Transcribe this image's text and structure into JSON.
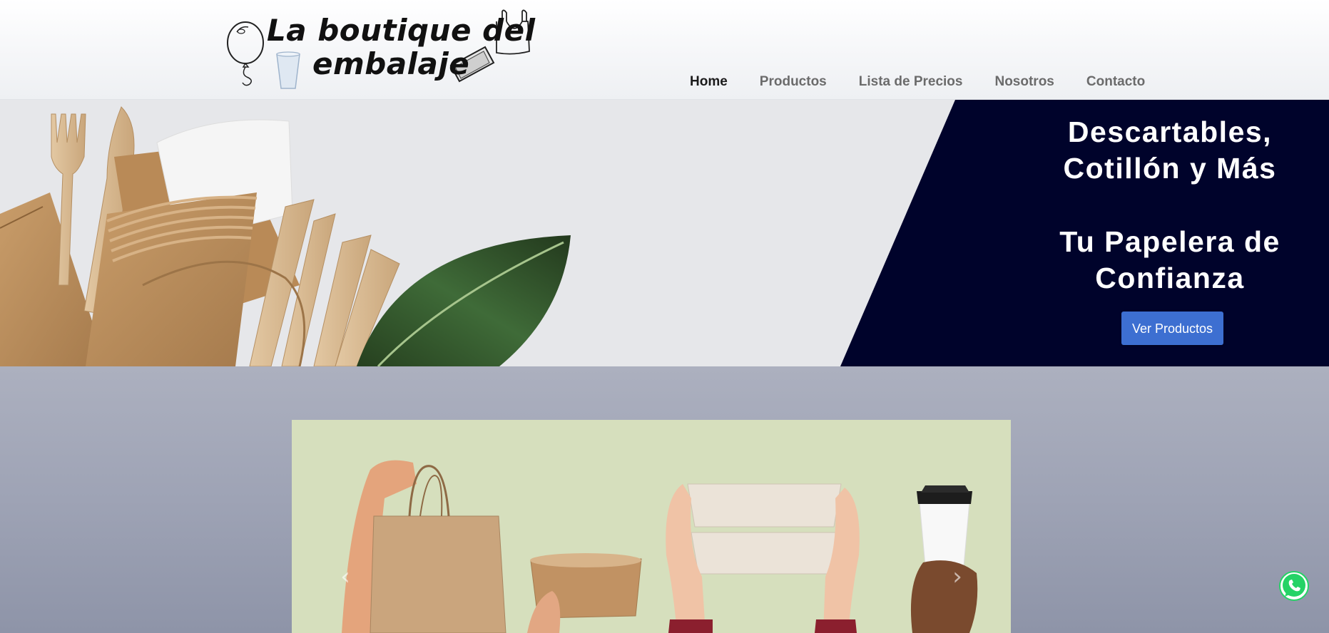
{
  "header": {
    "logo": {
      "line1": "La boutique del",
      "line2": "embalaje"
    },
    "nav": [
      {
        "label": "Home",
        "active": true
      },
      {
        "label": "Productos",
        "active": false
      },
      {
        "label": "Lista de Precios",
        "active": false
      },
      {
        "label": "Nosotros",
        "active": false
      },
      {
        "label": "Contacto",
        "active": false
      }
    ]
  },
  "hero": {
    "title_line1": "Descartables,",
    "title_line2": "Cotillón y Más",
    "subtitle_line1": "Tu Papelera de",
    "subtitle_line2": "Confianza",
    "cta_label": "Ver Productos"
  },
  "carousel": {
    "prev_icon": "chevron-left-icon",
    "next_icon": "chevron-right-icon"
  },
  "floating": {
    "icon": "whatsapp-icon"
  },
  "colors": {
    "hero_panel": "#00032b",
    "cta": "#3d6fd1",
    "carousel_bg": "#d6dfbd",
    "nav_active": "#1b1b1b",
    "nav_inactive": "#6b6b6b",
    "whatsapp": "#25d366"
  }
}
